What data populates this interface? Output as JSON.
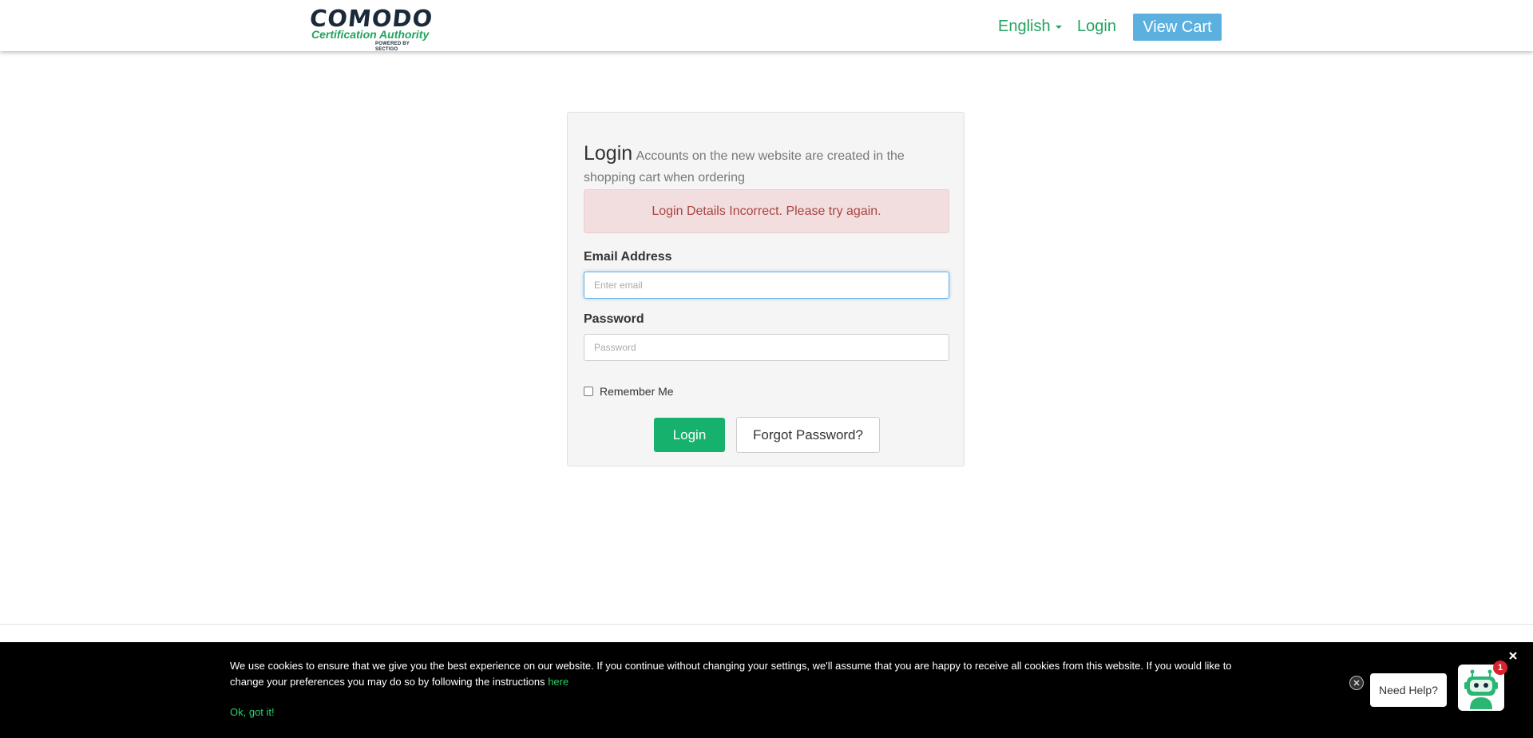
{
  "header": {
    "logo": {
      "wordmark": "COMODO",
      "tagline": "Certification Authority",
      "powered_by": "POWERED BY SECTIGO"
    },
    "language": "English",
    "login_link": "Login",
    "view_cart": "View Cart"
  },
  "login_form": {
    "title": "Login",
    "subtitle": "Accounts on the new website are created in the shopping cart when ordering",
    "error_message": "Login Details Incorrect. Please try again.",
    "email_label": "Email Address",
    "email_placeholder": "Enter email",
    "email_value": "",
    "password_label": "Password",
    "password_placeholder": "Password",
    "password_value": "",
    "remember_label": "Remember Me",
    "remember_checked": false,
    "login_button": "Login",
    "forgot_button": "Forgot Password?"
  },
  "cookie_banner": {
    "text": "We use cookies to ensure that we give you the best experience on our website. If you continue without changing your settings, we'll assume that you are happy to receive all cookies from this website. If you would like to change your preferences you may do so by following the instructions",
    "link_text": "here",
    "ok_text": "Ok, got it!"
  },
  "chat_widget": {
    "prompt": "Need Help?",
    "badge_count": "1",
    "icon": "robot-icon"
  },
  "colors": {
    "brand_green": "#21a35e",
    "login_button": "#16b26d",
    "view_cart_button": "#5bb0e0",
    "error_bg": "#f2dede",
    "error_text": "#a94442",
    "cookie_link": "#2bd06b",
    "badge_red": "#d9232d"
  }
}
